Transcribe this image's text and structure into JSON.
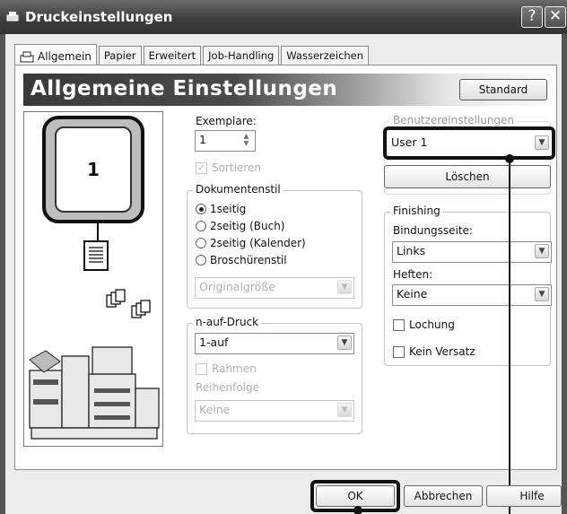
{
  "window": {
    "title": "Druckeinstellungen",
    "help_glyph": "?",
    "close_glyph": "✕"
  },
  "tabs": [
    {
      "label": "Allgemein",
      "active": true
    },
    {
      "label": "Papier"
    },
    {
      "label": "Erweitert"
    },
    {
      "label": "Job-Handling"
    },
    {
      "label": "Wasserzeichen"
    }
  ],
  "banner": {
    "title": "Allgemeine Einstellungen",
    "standard_button": "Standard"
  },
  "preview": {
    "page_number": "1"
  },
  "copies": {
    "label": "Exemplare:",
    "value": "1"
  },
  "collate": {
    "label": "Sortieren",
    "checked": true,
    "enabled": false
  },
  "document_style": {
    "title": "Dokumentenstil",
    "options": [
      "1seitig",
      "2seitig (Buch)",
      "2seitig (Kalender)",
      "Broschürenstil"
    ],
    "selected": "1seitig",
    "size_select": "Originalgröße"
  },
  "n_up": {
    "title": "n-auf-Druck",
    "value": "1-auf",
    "border_label": "Rahmen",
    "order_label": "Reihenfolge",
    "order_value": "Keine"
  },
  "user_settings": {
    "title": "Benutzereinstellungen",
    "value": "User 1",
    "delete_button": "Löschen"
  },
  "finishing": {
    "title": "Finishing",
    "binding_label": "Bindungsseite:",
    "binding_value": "Links",
    "staple_label": "Heften:",
    "staple_value": "Keine",
    "punch_label": "Lochung",
    "no_offset_label": "Kein Versatz"
  },
  "footer": {
    "ok": "OK",
    "cancel": "Abbrechen",
    "help": "Hilfe"
  }
}
